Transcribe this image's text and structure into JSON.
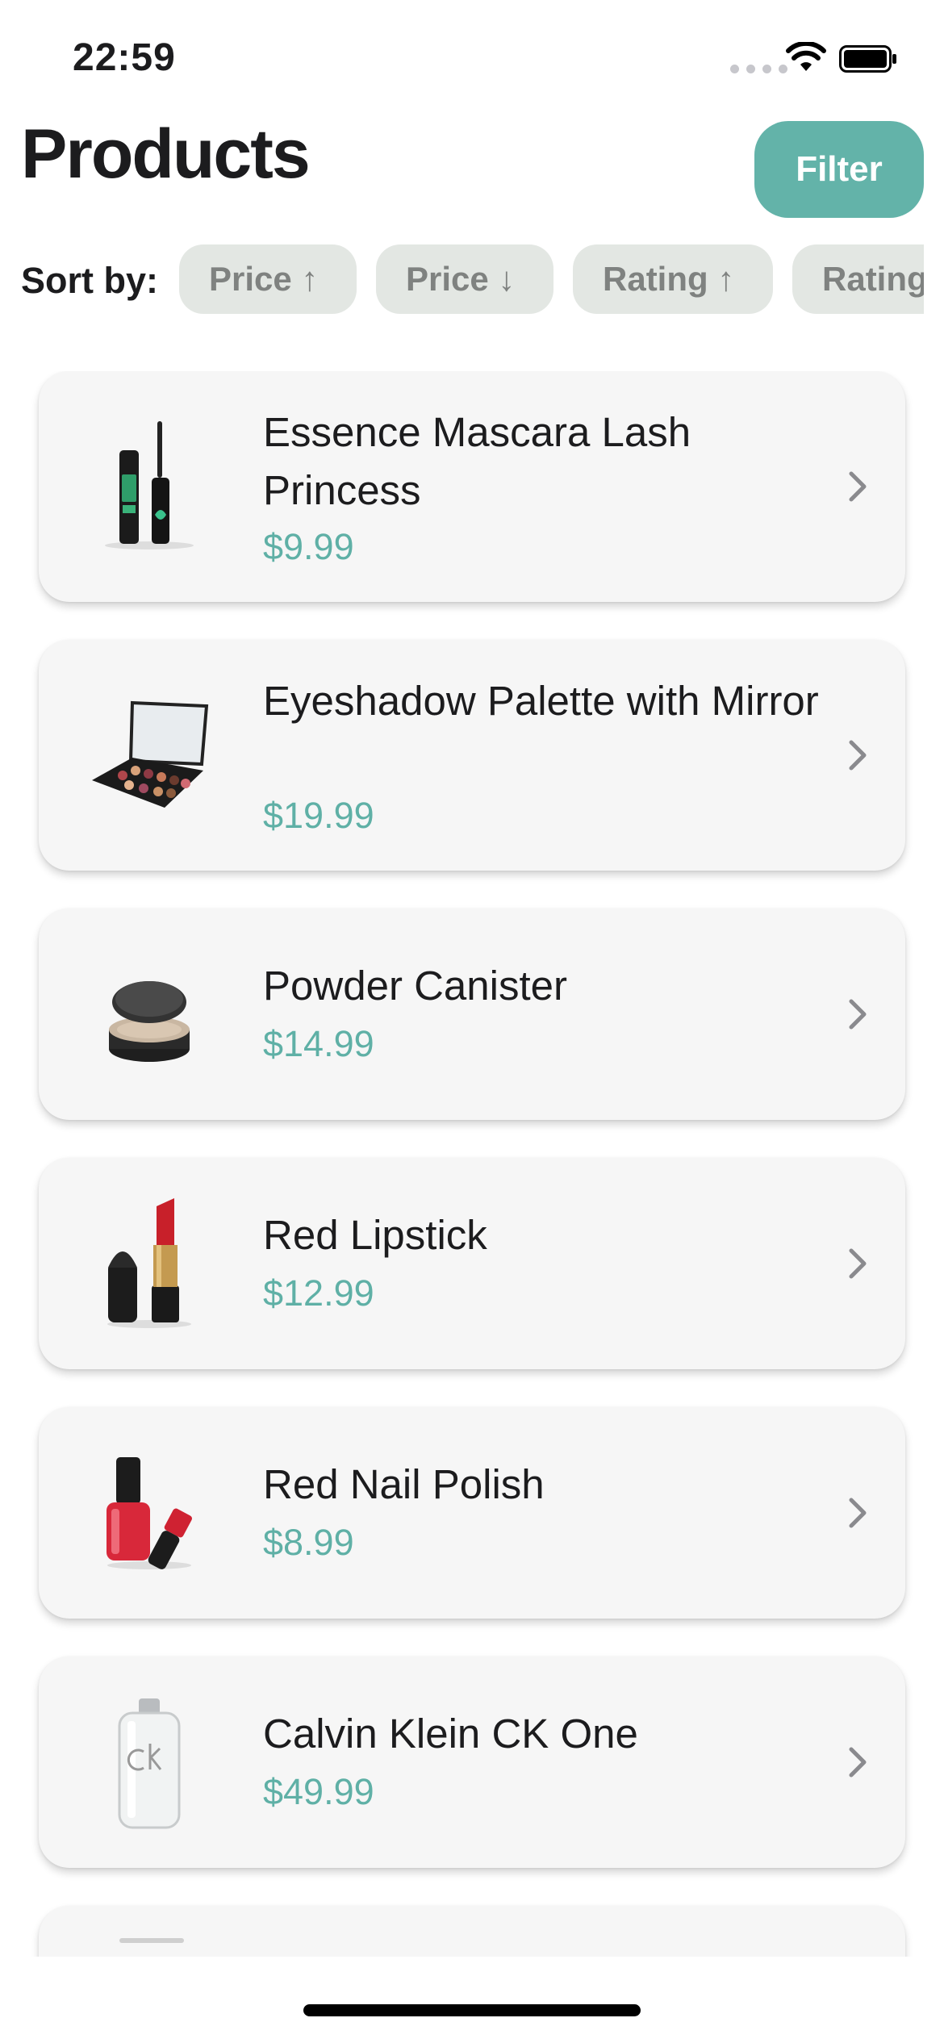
{
  "status_bar": {
    "time": "22:59"
  },
  "header": {
    "title": "Products",
    "filter_label": "Filter"
  },
  "sort": {
    "label": "Sort by:",
    "options": [
      {
        "label": "Price ↑"
      },
      {
        "label": "Price ↓"
      },
      {
        "label": "Rating ↑"
      },
      {
        "label": "Rating ↓"
      }
    ]
  },
  "products": [
    {
      "name": "Essence Mascara Lash Princess",
      "price": "$9.99",
      "icon": "mascara-icon"
    },
    {
      "name": "Eyeshadow Palette with Mirror",
      "price": "$19.99",
      "icon": "eyeshadow-palette-icon"
    },
    {
      "name": "Powder Canister",
      "price": "$14.99",
      "icon": "powder-canister-icon"
    },
    {
      "name": "Red Lipstick",
      "price": "$12.99",
      "icon": "lipstick-icon"
    },
    {
      "name": "Red Nail Polish",
      "price": "$8.99",
      "icon": "nail-polish-icon"
    },
    {
      "name": "Calvin Klein CK One",
      "price": "$49.99",
      "icon": "perfume-bottle-icon"
    }
  ],
  "colors": {
    "accent": "#63b3a9",
    "price": "#5fb0a6",
    "chip_bg": "#e3e7e3",
    "card_bg": "#f6f6f6"
  }
}
